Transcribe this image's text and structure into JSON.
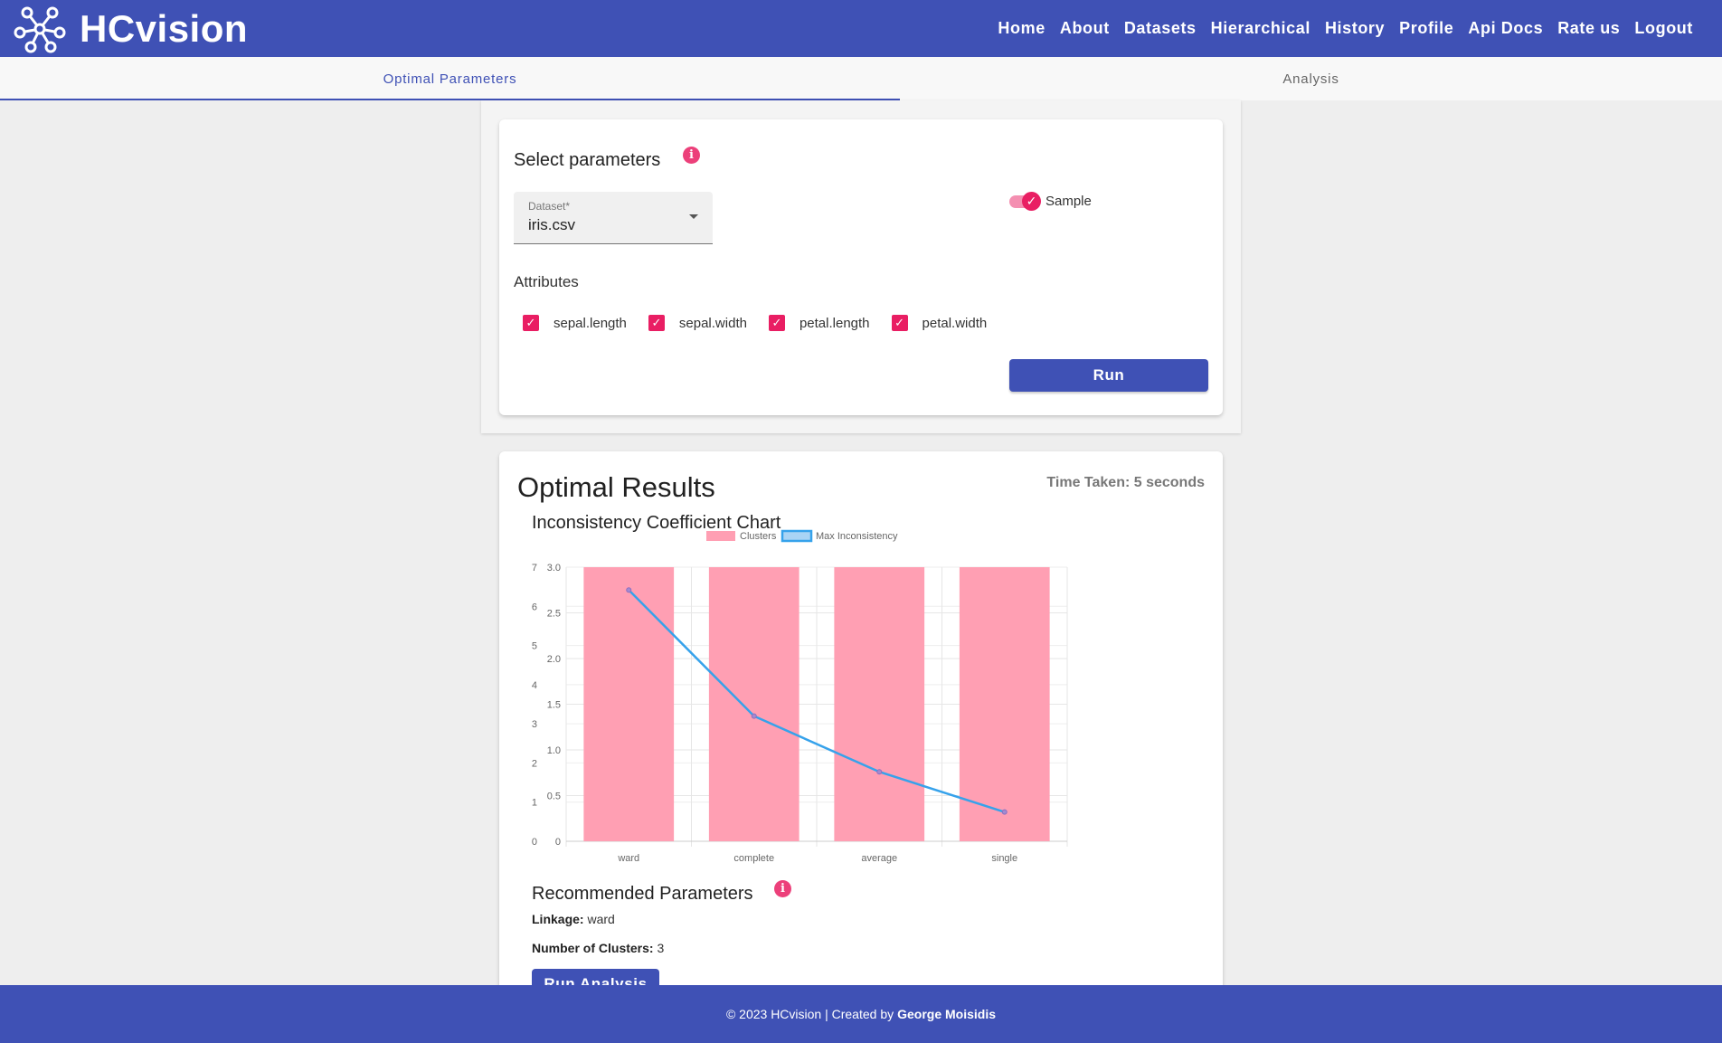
{
  "app": {
    "name": "HCvision"
  },
  "nav": {
    "items": [
      "Home",
      "About",
      "Datasets",
      "Hierarchical",
      "History",
      "Profile",
      "Api Docs",
      "Rate us",
      "Logout"
    ]
  },
  "tabs": [
    {
      "label": "Optimal Parameters",
      "active": true
    },
    {
      "label": "Analysis",
      "active": false
    }
  ],
  "params": {
    "title": "Select parameters",
    "info_icon": "info-icon",
    "dataset_label": "Dataset*",
    "dataset_value": "iris.csv",
    "sample_label": "Sample",
    "sample_on": true,
    "attributes_title": "Attributes",
    "attributes": [
      {
        "label": "sepal.length",
        "checked": true
      },
      {
        "label": "sepal.width",
        "checked": true
      },
      {
        "label": "petal.length",
        "checked": true
      },
      {
        "label": "petal.width",
        "checked": true
      }
    ],
    "run_label": "Run"
  },
  "results": {
    "title": "Optimal Results",
    "time_taken": "Time Taken: 5 seconds",
    "chart_title": "Inconsistency Coefficient Chart"
  },
  "recommended": {
    "title": "Recommended Parameters",
    "linkage_label": "Linkage:",
    "linkage_value": "ward",
    "clusters_label": "Number of Clusters:",
    "clusters_value": "3",
    "run_analysis_label": "Run Analysis"
  },
  "footer": {
    "text": "© 2023 HCvision | Created by",
    "author": "George Moisidis"
  },
  "colors": {
    "primary": "#3f51b5",
    "accent": "#e91e63",
    "bar_fill": "#ff9fb3",
    "line": "#36a2eb"
  },
  "chart_data": {
    "type": "bar",
    "categories": [
      "ward",
      "complete",
      "average",
      "single"
    ],
    "series": [
      {
        "name": "Clusters",
        "type": "bar",
        "axis": "left",
        "values": [
          7,
          7,
          7,
          7
        ]
      },
      {
        "name": "Max Inconsistency",
        "type": "line",
        "axis": "right",
        "values": [
          2.75,
          1.37,
          0.76,
          0.32
        ]
      }
    ],
    "y_left": {
      "ticks": [
        "0",
        "1",
        "2",
        "3",
        "4",
        "5",
        "6",
        "7"
      ],
      "ylim": [
        0,
        7
      ]
    },
    "y_right": {
      "ticks": [
        "0",
        "0.5",
        "1.0",
        "1.5",
        "2.0",
        "2.5",
        "3.0"
      ],
      "ylim": [
        0,
        3
      ]
    },
    "legend": "top",
    "grid": true
  }
}
